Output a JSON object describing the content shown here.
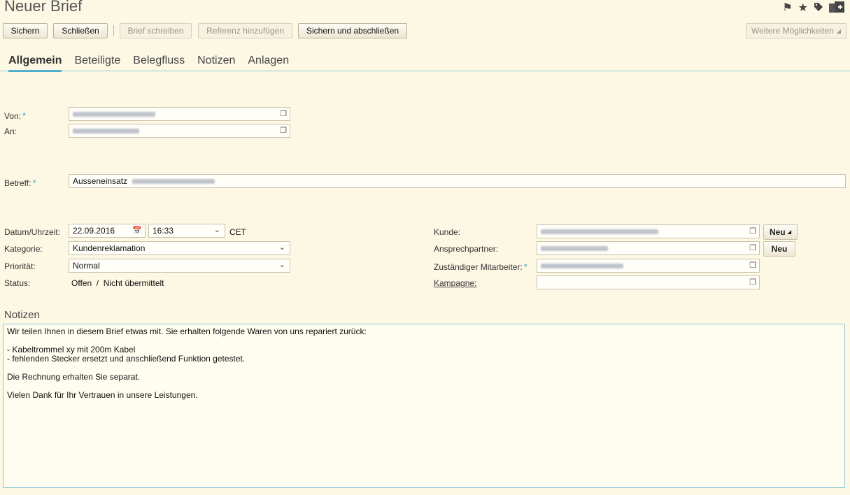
{
  "window": {
    "title": "Neuer Brief"
  },
  "top_icons": [
    "flag-icon",
    "star-icon",
    "tag-icon",
    "add-document-icon"
  ],
  "toolbar": {
    "save": "Sichern",
    "close": "Schließen",
    "write_letter": "Brief schreiben",
    "add_reference": "Referenz hinzufügen",
    "save_and_close": "Sichern und abschließen",
    "more_options": "Weitere Möglichkeiten"
  },
  "tabs": [
    "Allgemein",
    "Beteiligte",
    "Belegfluss",
    "Notizen",
    "Anlagen"
  ],
  "form": {
    "von_label": "Von:",
    "an_label": "An:",
    "betreff_label": "Betreff:",
    "betreff_value": "Ausseneinsatz",
    "datum_label": "Datum/Uhrzeit:",
    "date_value": "22.09.2016",
    "time_value": "16:33",
    "timezone": "CET",
    "kategorie_label": "Kategorie:",
    "kategorie_value": "Kundenreklamation",
    "prioritaet_label": "Priorität:",
    "prioritaet_value": "Normal",
    "status_label": "Status:",
    "status_value": "Offen  /  Nicht übermittelt",
    "kunde_label": "Kunde:",
    "ansprechpartner_label": "Ansprechpartner:",
    "mitarbeiter_label": "Zuständiger Mitarbeiter:",
    "kampagne_label": "Kampagne:",
    "neu_label": "Neu"
  },
  "notes": {
    "heading": "Notizen",
    "text": "Wir teilen Ihnen in diesem Brief etwas mit. Sie erhalten folgende Waren von uns repariert zurück:\n\n- Kabeltrommel xy mit 200m Kabel\n- fehlenden Stecker ersetzt und anschließend Funktion getestet.\n\nDie Rechnung erhalten Sie separat.\n\nVielen Dank für Ihr Vertrauen in unsere Leistungen."
  },
  "colors": {
    "background": "#fdf8e4",
    "accent": "#3aa7c8"
  }
}
